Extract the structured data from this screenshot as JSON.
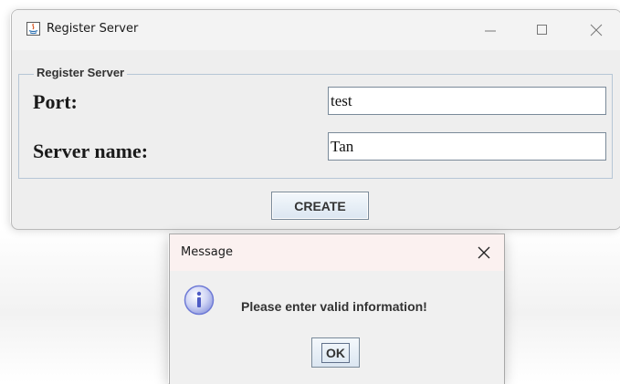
{
  "main_window": {
    "title": "Register Server",
    "group_title": "Register Server",
    "fields": {
      "port_label": "Port:",
      "port_value": "test",
      "server_name_label": "Server name:",
      "server_name_value": "Tan"
    },
    "create_label": "CREATE",
    "icons": {
      "app": "java-icon",
      "minimize": "minimize-icon",
      "maximize": "maximize-icon",
      "close": "close-icon"
    }
  },
  "message_dialog": {
    "title": "Message",
    "message": "Please enter valid information!",
    "ok_label": "OK",
    "icons": {
      "info": "info-icon",
      "close": "close-icon"
    }
  },
  "colors": {
    "button_border": "#7a8a99",
    "group_border": "#b6c6d6",
    "info_icon": "#6f7bd6",
    "dialog_titlebar": "#fbf1f0"
  }
}
